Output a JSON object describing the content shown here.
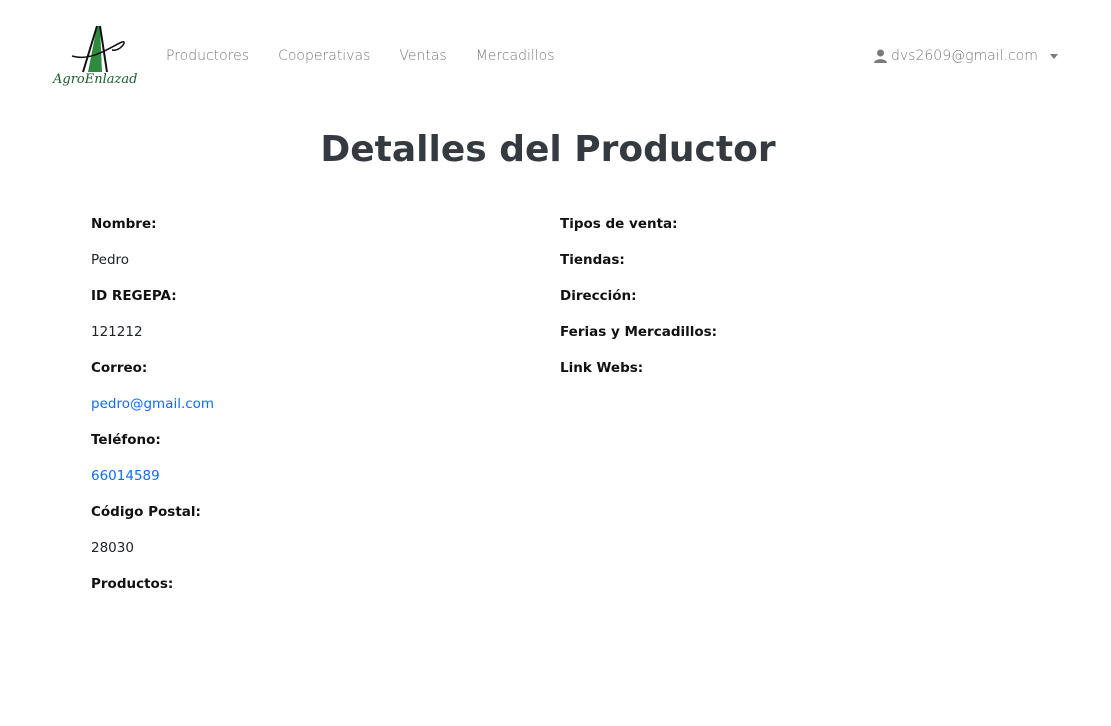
{
  "brand": {
    "logo_text": "AgroEnlazados"
  },
  "nav": {
    "items": [
      "Productores",
      "Cooperativas",
      "Ventas",
      "Mercadillos"
    ]
  },
  "user": {
    "email": "dvs2609@gmail.com"
  },
  "page": {
    "title": "Detalles del Productor"
  },
  "left": {
    "nombre_label": "Nombre:",
    "nombre_value": "Pedro",
    "regepa_label": "ID REGEPA:",
    "regepa_value": "121212",
    "correo_label": "Correo:",
    "correo_value": "pedro@gmail.com",
    "telefono_label": "Teléfono:",
    "telefono_value": "66014589",
    "cp_label": "Código Postal:",
    "cp_value": "28030",
    "productos_label": "Productos:"
  },
  "right": {
    "tipos_label": "Tipos de venta:",
    "tiendas_label": "Tiendas:",
    "direccion_label": "Dirección:",
    "ferias_label": "Ferias y Mercadillos:",
    "webs_label": "Link Webs:"
  },
  "colors": {
    "link": "#0d6efd",
    "logo_green": "#2e8b3d",
    "title": "#343a40"
  }
}
